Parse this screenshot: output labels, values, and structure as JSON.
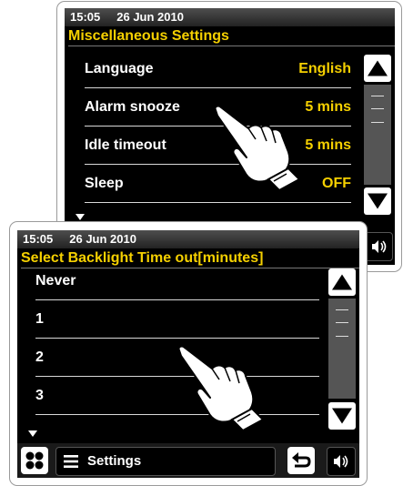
{
  "back_screen": {
    "time": "15:05",
    "date": "26 Jun 2010",
    "title": "Miscellaneous Settings",
    "rows": [
      {
        "label": "Language",
        "value": "English"
      },
      {
        "label": "Alarm snooze",
        "value": "5 mins"
      },
      {
        "label": "Idle timeout",
        "value": "5 mins"
      },
      {
        "label": "Sleep",
        "value": "OFF"
      }
    ]
  },
  "front_screen": {
    "time": "15:05",
    "date": "26 Jun 2010",
    "title": "Select Backlight Time out[minutes]",
    "options": [
      "Never",
      "1",
      "2",
      "3"
    ],
    "bottom_bar": {
      "settings_label": "Settings"
    }
  },
  "icons": {
    "scroll_up": "triangle-up-icon",
    "scroll_down": "triangle-down-icon",
    "volume": "speaker-icon",
    "back": "return-arrow-icon",
    "home": "four-circles-icon",
    "menu": "hamburger-icon",
    "pointer": "pointing-hand-icon"
  },
  "colors": {
    "accent": "#f5d000",
    "screen_bg": "#000000",
    "status_bar": "#3a3a3a"
  }
}
